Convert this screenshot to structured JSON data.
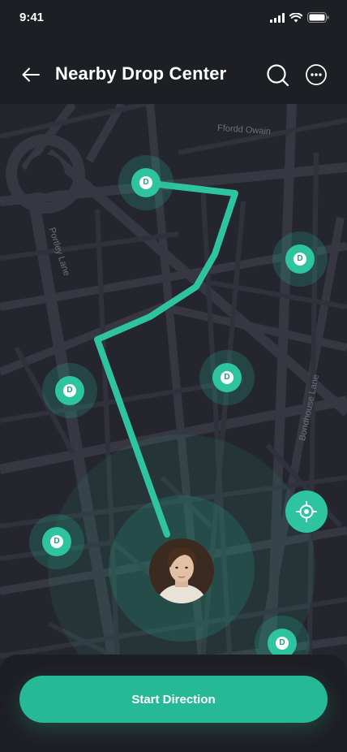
{
  "status_bar": {
    "time": "9:41"
  },
  "header": {
    "title": "Nearby Drop Center"
  },
  "map": {
    "streets": [
      "Ffordd Owain",
      "Portley Lane",
      "Bondhouse Lane"
    ],
    "marker_label": "D"
  },
  "actions": {
    "start_label": "Start Direction"
  },
  "colors": {
    "accent": "#2ec4a0",
    "background": "#1e1f24",
    "map": "#25262d",
    "road": "#3a3b43"
  },
  "icons": [
    "back-arrow-icon",
    "search-icon",
    "more-icon",
    "location-target-icon",
    "drop-center-pin-icon"
  ]
}
